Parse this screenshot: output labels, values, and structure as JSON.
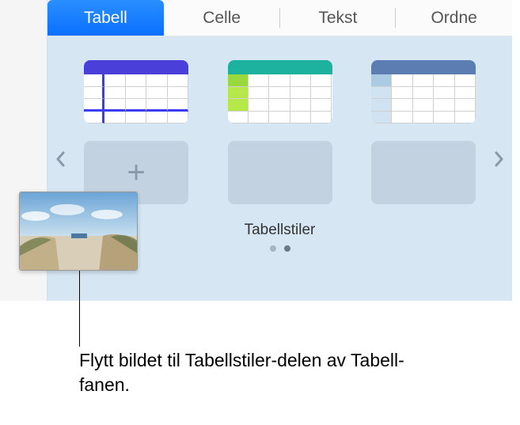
{
  "tabs": {
    "tabell": "Tabell",
    "celle": "Celle",
    "tekst": "Tekst",
    "ordne": "Ordne"
  },
  "styles": {
    "section_label": "Tabellstiler"
  },
  "callout": {
    "text": "Flytt bildet til Tabellstiler-delen av Tabell-fanen."
  }
}
